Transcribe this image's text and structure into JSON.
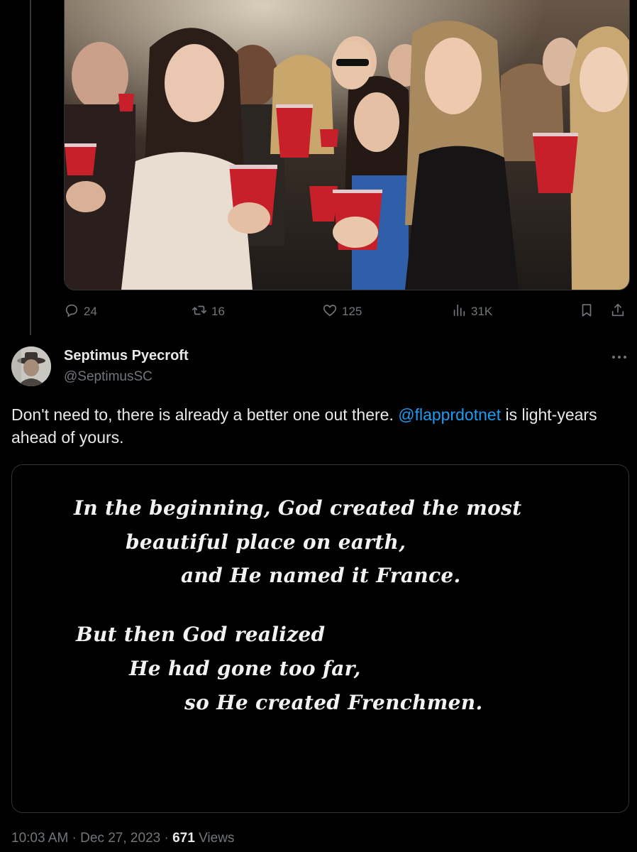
{
  "thread": {
    "media_alt": "party photo",
    "actions": {
      "reply_count": "24",
      "retweet_count": "16",
      "like_count": "125",
      "views_count": "31K"
    }
  },
  "reply": {
    "author_name": "Septimus Pyecroft",
    "author_handle": "@SeptimusSC",
    "text_before_mention": "Don't need to, there is already a better one out there. ",
    "mention": "@flapprdotnet",
    "text_after_mention": " is light-years ahead of yours.",
    "quote_image_lines": [
      "In the beginning, God created the most",
      "beautiful place on earth,",
      "and He named it France.",
      "But then God realized",
      "He had gone too far,",
      "so He created Frenchmen."
    ],
    "time": "10:03 AM",
    "separator": " · ",
    "date": "Dec 27, 2023",
    "views_count": "671",
    "views_label": " Views"
  },
  "colors": {
    "background": "#000000",
    "text_primary": "#e7e9ea",
    "text_secondary": "#71767b",
    "accent": "#1d9bf0",
    "border": "#2f3336",
    "cup_red": "#c8202a"
  },
  "icons": {
    "reply": "reply-icon",
    "retweet": "retweet-icon",
    "like": "heart-icon",
    "views": "views-chart-icon",
    "bookmark": "bookmark-icon",
    "share": "share-icon",
    "more": "more-dots-icon"
  }
}
